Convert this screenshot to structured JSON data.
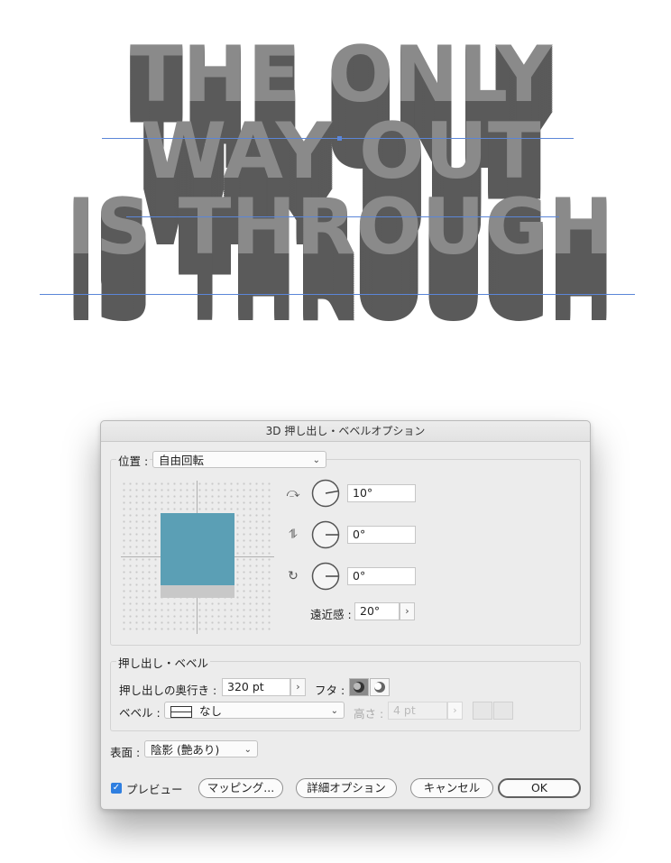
{
  "artwork": {
    "lines": [
      "THE ONLY",
      "WAY OUT",
      "IS THROUGH"
    ],
    "face_color": "#8a8a8a",
    "extrude_color": "#5a5a5a",
    "guide_color": "#5b86d8"
  },
  "dialog": {
    "title": "3D 押し出し・ベベルオプション",
    "position": {
      "label": "位置 :",
      "select_value": "自由回転",
      "rotations": [
        {
          "icon": "rotate-x-icon",
          "value": "10°",
          "angle": 10
        },
        {
          "icon": "rotate-y-icon",
          "value": "0°",
          "angle": 0
        },
        {
          "icon": "rotate-z-icon",
          "value": "0°",
          "angle": 0
        }
      ],
      "perspective_label": "遠近感 :",
      "perspective_value": "20°",
      "cube_face_color": "#5b9fb5",
      "cube_side_color": "#c8c8c8"
    },
    "extrude": {
      "group_label": "押し出し・ベベル",
      "depth_label": "押し出しの奥行き :",
      "depth_value": "320 pt",
      "cap_label": "フタ :",
      "bevel_label": "ベベル :",
      "bevel_value": "なし",
      "height_label": "高さ :",
      "height_value": "4 pt"
    },
    "surface": {
      "label": "表面 :",
      "value": "陰影 (艶あり)"
    },
    "footer": {
      "preview_label": "プレビュー",
      "preview_checked": true,
      "mapping_button": "マッピング...",
      "more_options_button": "詳細オプション",
      "cancel_button": "キャンセル",
      "ok_button": "OK"
    }
  }
}
